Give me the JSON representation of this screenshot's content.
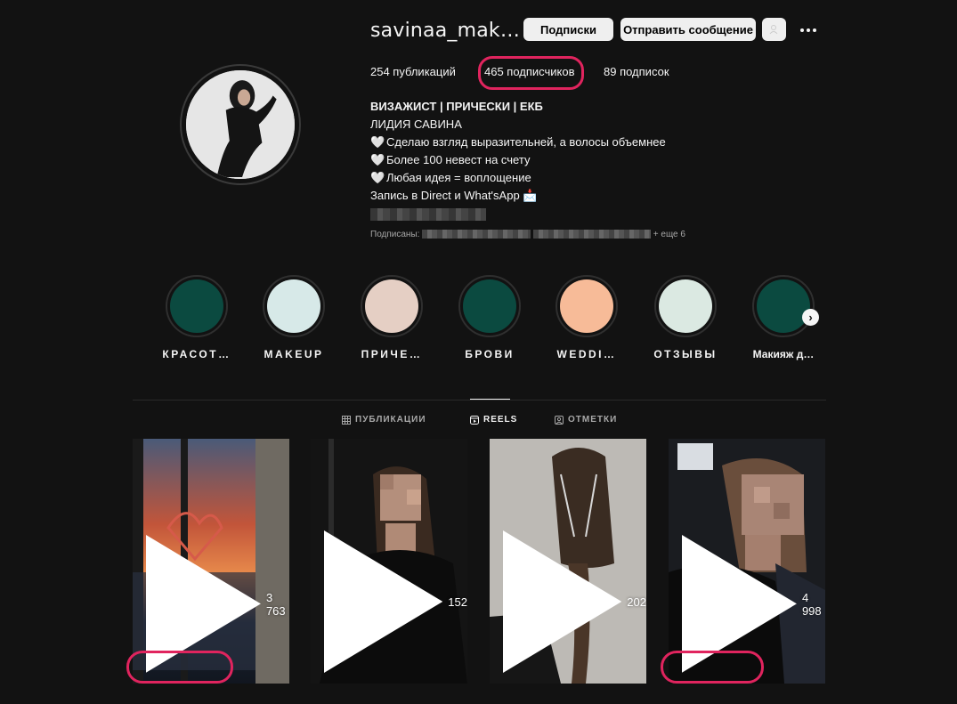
{
  "profile": {
    "username": "savinaa_mak…",
    "follow_button": "Подписки",
    "message_button": "Отправить сообщение",
    "posts_stat": "254 публикаций",
    "followers_stat": "465 подписчиков",
    "following_stat": "89 подписок"
  },
  "bio": {
    "title": "ВИЗАЖИСТ | ПРИЧЕСКИ | ЕКБ",
    "name": "ЛИДИЯ САВИНА",
    "line1": "Сделаю взгляд выразительней, а волосы объемнее",
    "line2": "Более 100 невест на счету",
    "line3": "Любая идея = воплощение",
    "line4": "Запись в Direct и What'sApp 📩",
    "heart": "🤍",
    "followed_by_prefix": "Подписаны:",
    "followed_by_suffix": "+ еще 6"
  },
  "highlights": [
    {
      "label": "КРАСОТ…",
      "color": "#0b4a40"
    },
    {
      "label": "MAKEUP",
      "color": "#d7e9e8"
    },
    {
      "label": "ПРИЧЕ…",
      "color": "#e5cfc4"
    },
    {
      "label": "БРОВИ",
      "color": "#0b4a40"
    },
    {
      "label": "WEDDI…",
      "color": "#f7bb98"
    },
    {
      "label": "ОТЗЫВЫ",
      "color": "#dbe9e2"
    },
    {
      "label": "Макияж д…",
      "color": "#0b4a40"
    }
  ],
  "tabs": {
    "posts": "ПУБЛИКАЦИИ",
    "reels": "REELS",
    "tagged": "ОТМЕТКИ"
  },
  "reels": [
    {
      "views": "3 763"
    },
    {
      "views": "152"
    },
    {
      "views": "202"
    },
    {
      "views": "4 998"
    }
  ],
  "colors": {
    "background": "#121212",
    "highlight_annotation": "#e0245e",
    "button_bg": "#efefef"
  }
}
